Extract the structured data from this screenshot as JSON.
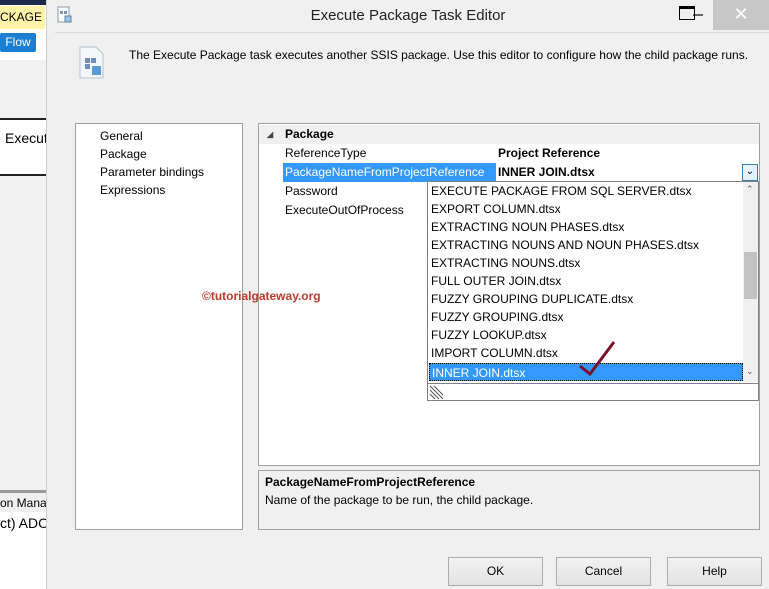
{
  "background": {
    "tab_label": "CKAGE F",
    "flow_label": "Flow",
    "task_label": "Execut Packag",
    "conn_label": "on Mana",
    "ado_label": "ct) ADO"
  },
  "window": {
    "title": "Execute Package Task Editor",
    "close_glyph": "✕"
  },
  "header": {
    "description": "The Execute Package task executes another SSIS package. Use this editor to configure how the child package runs."
  },
  "nav": {
    "items": [
      {
        "label": "General"
      },
      {
        "label": "Package"
      },
      {
        "label": "Parameter bindings"
      },
      {
        "label": "Expressions"
      }
    ]
  },
  "grid": {
    "category": "Package",
    "collapse_glyph": "◢",
    "rows": [
      {
        "name": "ReferenceType",
        "value": "Project Reference"
      },
      {
        "name": "PackageNameFromProjectReference",
        "value": "INNER JOIN.dtsx"
      },
      {
        "name": "Password",
        "value": ""
      },
      {
        "name": "ExecuteOutOfProcess",
        "value": ""
      }
    ]
  },
  "dropdown": {
    "items": [
      "EXECUTE PACKAGE FROM SQL SERVER.dtsx",
      "EXPORT COLUMN.dtsx",
      "EXTRACTING NOUN PHASES.dtsx",
      "EXTRACTING NOUNS AND NOUN PHASES.dtsx",
      "EXTRACTING NOUNS.dtsx",
      "FULL OUTER JOIN.dtsx",
      "FUZZY GROUPING DUPLICATE.dtsx",
      "FUZZY GROUPING.dtsx",
      "FUZZY LOOKUP.dtsx",
      "IMPORT COLUMN.dtsx",
      "INNER JOIN.dtsx"
    ],
    "selected": "INNER JOIN.dtsx"
  },
  "help": {
    "title": "PackageNameFromProjectReference",
    "text": "Name of the package to be run, the child package."
  },
  "watermark": "©tutorialgateway.org",
  "buttons": {
    "ok": "OK",
    "cancel": "Cancel",
    "help": "Help"
  },
  "colors": {
    "selection": "#3399ff",
    "watermark": "#c0392b"
  }
}
